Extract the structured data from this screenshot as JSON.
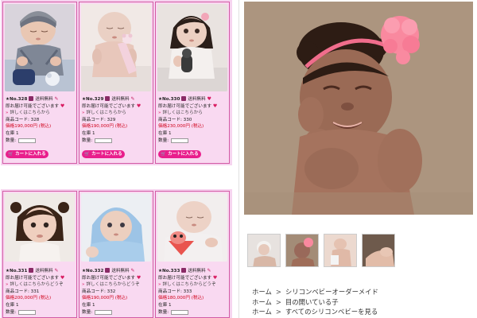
{
  "products": [
    {
      "no": "★No.328",
      "shipping": "送料無料",
      "ready": "即お届け可能でございます",
      "detail_link": "詳しくはこちらから",
      "code": "商品コード: 328",
      "price": "価格190,000円 (税込)",
      "stock": "在庫 1",
      "qty_label": "数量:",
      "cart_label": "カートに入れる"
    },
    {
      "no": "★No.329",
      "shipping": "送料無料",
      "ready": "即お届け可能でございます",
      "detail_link": "詳しくはこちらから",
      "code": "商品コード: 329",
      "price": "価格190,000円 (税込)",
      "stock": "在庫 1",
      "qty_label": "数量:",
      "cart_label": "カートに入れる"
    },
    {
      "no": "★No.330",
      "shipping": "送料無料",
      "ready": "即お届け可能でございます",
      "detail_link": "詳しくはこちらから",
      "code": "商品コード: 330",
      "price": "価格230,000円 (税込)",
      "stock": "在庫 1",
      "qty_label": "数量:",
      "cart_label": "カートに入れる"
    },
    {
      "no": "★No.331",
      "shipping": "送料無料",
      "ready": "即お届け可能でございます",
      "detail_link": "詳しくはこちらからどうぞ",
      "code": "商品コード: 331",
      "price": "価格200,000円 (税込)",
      "stock": "在庫 1",
      "qty_label": "数量:"
    },
    {
      "no": "★No.332",
      "shipping": "送料無料",
      "ready": "即お届け可能でございます",
      "detail_link": "詳しくはこちらからどうぞ",
      "code": "商品コード: 332",
      "price": "価格190,000円 (税込)",
      "stock": "在庫 1",
      "qty_label": "数量:"
    },
    {
      "no": "★No.333",
      "shipping": "送料無料",
      "ready": "即お届け可能でございます",
      "detail_link": "詳しくはこちらからどうぞ",
      "code": "商品コード: 333",
      "price": "価格180,000円 (税込)",
      "stock": "在庫 1",
      "qty_label": "数量:"
    }
  ],
  "breadcrumbs": [
    {
      "home": "ホーム",
      "sep": ">",
      "label": "シリコンベビーオーダーメイド"
    },
    {
      "home": "ホーム",
      "sep": ">",
      "label": "目の開いている子"
    },
    {
      "home": "ホーム",
      "sep": ">",
      "label": "すべてのシリコンベビーを見る"
    }
  ],
  "colors": {
    "panel_bg": "#f6d4ef",
    "card_border": "#d35aa5",
    "cart_button": "#e91e8c",
    "heart": "#d81b60",
    "headband": "#f06d8c"
  }
}
